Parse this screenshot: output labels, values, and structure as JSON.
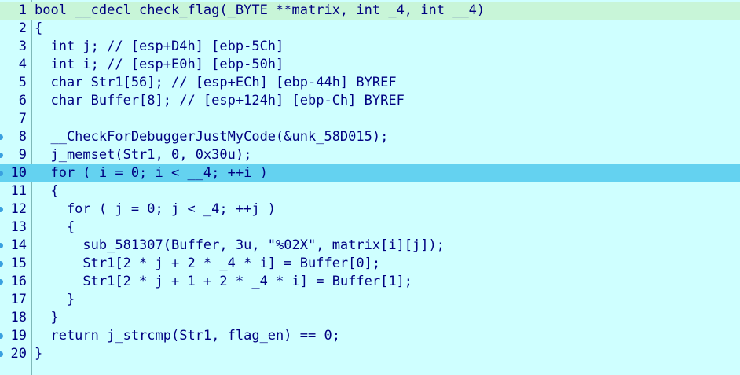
{
  "editor": {
    "lines": [
      {
        "number": "1",
        "text": "bool __cdecl check_flag(_BYTE **matrix, int _4, int __4)",
        "has_dot": false
      },
      {
        "number": "2",
        "text": "{",
        "has_dot": false
      },
      {
        "number": "3",
        "text": "  int j; // [esp+D4h] [ebp-5Ch]",
        "has_dot": false
      },
      {
        "number": "4",
        "text": "  int i; // [esp+E0h] [ebp-50h]",
        "has_dot": false
      },
      {
        "number": "5",
        "text": "  char Str1[56]; // [esp+ECh] [ebp-44h] BYREF",
        "has_dot": false
      },
      {
        "number": "6",
        "text": "  char Buffer[8]; // [esp+124h] [ebp-Ch] BYREF",
        "has_dot": false
      },
      {
        "number": "7",
        "text": "",
        "has_dot": false
      },
      {
        "number": "8",
        "text": "  __CheckForDebuggerJustMyCode(&unk_58D015);",
        "has_dot": true
      },
      {
        "number": "9",
        "text": "  j_memset(Str1, 0, 0x30u);",
        "has_dot": true
      },
      {
        "number": "10",
        "text": "  for ( i = 0; i < __4; ++i )",
        "has_dot": true
      },
      {
        "number": "11",
        "text": "  {",
        "has_dot": false
      },
      {
        "number": "12",
        "text": "    for ( j = 0; j < _4; ++j )",
        "has_dot": true
      },
      {
        "number": "13",
        "text": "    {",
        "has_dot": false
      },
      {
        "number": "14",
        "text": "      sub_581307(Buffer, 3u, \"%02X\", matrix[i][j]);",
        "has_dot": true
      },
      {
        "number": "15",
        "text": "      Str1[2 * j + 2 * _4 * i] = Buffer[0];",
        "has_dot": true
      },
      {
        "number": "16",
        "text": "      Str1[2 * j + 1 + 2 * _4 * i] = Buffer[1];",
        "has_dot": true
      },
      {
        "number": "17",
        "text": "    }",
        "has_dot": false
      },
      {
        "number": "18",
        "text": "  }",
        "has_dot": false
      },
      {
        "number": "19",
        "text": "  return j_strcmp(Str1, flag_en) == 0;",
        "has_dot": true
      },
      {
        "number": "20",
        "text": "}",
        "has_dot": true
      }
    ],
    "highlighted_line": "10",
    "colors": {
      "background": "#cfffff",
      "highlight": "#64d2f0",
      "first_line": "#c8f5d8",
      "text": "#000080",
      "comment": "#8080c0",
      "string": "#008000",
      "breakpoint_dot": "#3aa0e0"
    }
  }
}
